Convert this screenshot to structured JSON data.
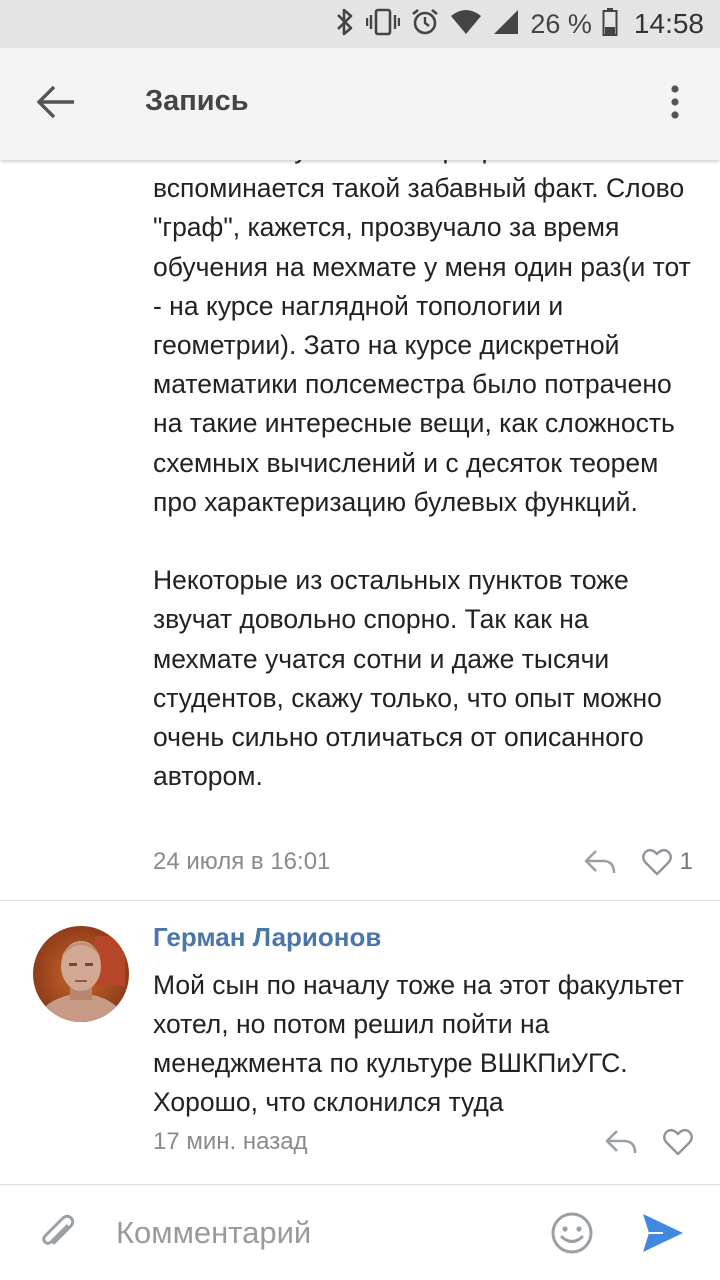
{
  "status_bar": {
    "battery_text": "26 %",
    "time": "14:58",
    "icons": [
      "bluetooth-icon",
      "vibrate-icon",
      "alarm-icon",
      "wifi-icon",
      "signal-icon",
      "battery-icon"
    ]
  },
  "app_bar": {
    "title": "Запись",
    "icons": [
      "back-arrow-icon",
      "more-vertical-icon"
    ]
  },
  "comment1": {
    "lines_partial_top": "На счёт актуальности программы мне",
    "paragraph1": "вспоминается такой забавный факт. Слово \"граф\", кажется, прозвучало за время обучения на мехмате у меня один раз(и тот - на курсе наглядной топологии и геометрии). Зато на курсе дискретной математики полсеместра было потрачено на такие интересные вещи, как сложность схемных вычислений и с десяток теорем про характеризацию булевых функций.",
    "paragraph2": "Некоторые из остальных пунктов тоже звучат довольно спорно. Так как на мехмате учатся сотни и даже тысячи студентов, скажу только, что опыт можно очень сильно отличаться от описанного автором.",
    "date": "24 июля в 16:01",
    "likes": "1"
  },
  "comment2": {
    "author": "Герман Ларионов",
    "text": "Мой сын по началу тоже на этот факультет хотел, но потом решил пойти на менеджмента по культуре ВШКПиУГС. Хорошо, что склонился туда",
    "date": "17 мин. назад"
  },
  "input_bar": {
    "placeholder": "Комментарий",
    "value": ""
  },
  "colors": {
    "accent": "#4a76a8",
    "send": "#3f8ae0",
    "status_bar_bg": "#e4e4e4",
    "app_bar_bg": "#f4f4f4",
    "meta_text": "#8a8a8a"
  }
}
